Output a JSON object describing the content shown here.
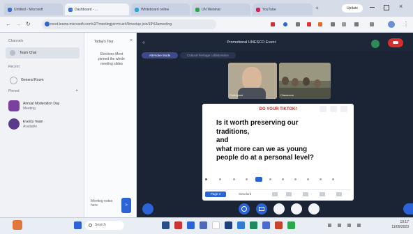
{
  "browser": {
    "tabs": [
      {
        "label": "Untitled - Microsoft",
        "color": "#3b6fd8"
      },
      {
        "label": "Dashboard - ...",
        "color": "#3b6fd8"
      },
      {
        "label": "Whiteboard online",
        "color": "#2aa8d6"
      },
      {
        "label": "UN Webinar",
        "color": "#2aa84a"
      },
      {
        "label": "YouTube",
        "color": "#d6245a"
      }
    ],
    "new_tab": "+",
    "url": "meet.teams.microsoft.com/v2/?meetingjoin=true#/l/meetup-join/19%3ameeting",
    "profile_label": "Update"
  },
  "left_panel": {
    "section1": "Channels",
    "item1": "Team Chat",
    "section2": "Recent",
    "item2": "General Room",
    "section3": "Pinned",
    "chats": [
      {
        "name": "Annual Moderation Day",
        "sub": "Meeting",
        "color": "#7b3fa0"
      },
      {
        "name": "Events Team",
        "sub": "Available",
        "color": "#5b3a8c"
      }
    ]
  },
  "mid_panel": {
    "title": "Today's Tour",
    "bubble": "Elections Meet pinned the whole meeting slides",
    "footer_text": "Meeting notes here",
    "send_label": ">"
  },
  "meeting": {
    "title": "Promotional UNESCO Event",
    "pill1": "Attendee Mode",
    "pill2": "Cultural heritage collaboration",
    "leave_label": "Leave",
    "videos": [
      {
        "name": "Participant"
      },
      {
        "name": "Classroom"
      }
    ]
  },
  "slide": {
    "heading": "DO YOUR TIKTOK!",
    "lines": [
      "Is it worth preserving our",
      "traditions,",
      "and",
      "what more can we as young",
      "people do at a personal level?"
    ],
    "page_label": "Page 3",
    "select_label": "Standard"
  },
  "taskbar": {
    "search_placeholder": "Search",
    "time": "10:17",
    "date": "11/09/2023"
  },
  "colors": {
    "stage_bg": "#1b2434",
    "accent_blue": "#2c64d8",
    "leave_red": "#d32f2f",
    "slide_heading": "#d9281c"
  }
}
